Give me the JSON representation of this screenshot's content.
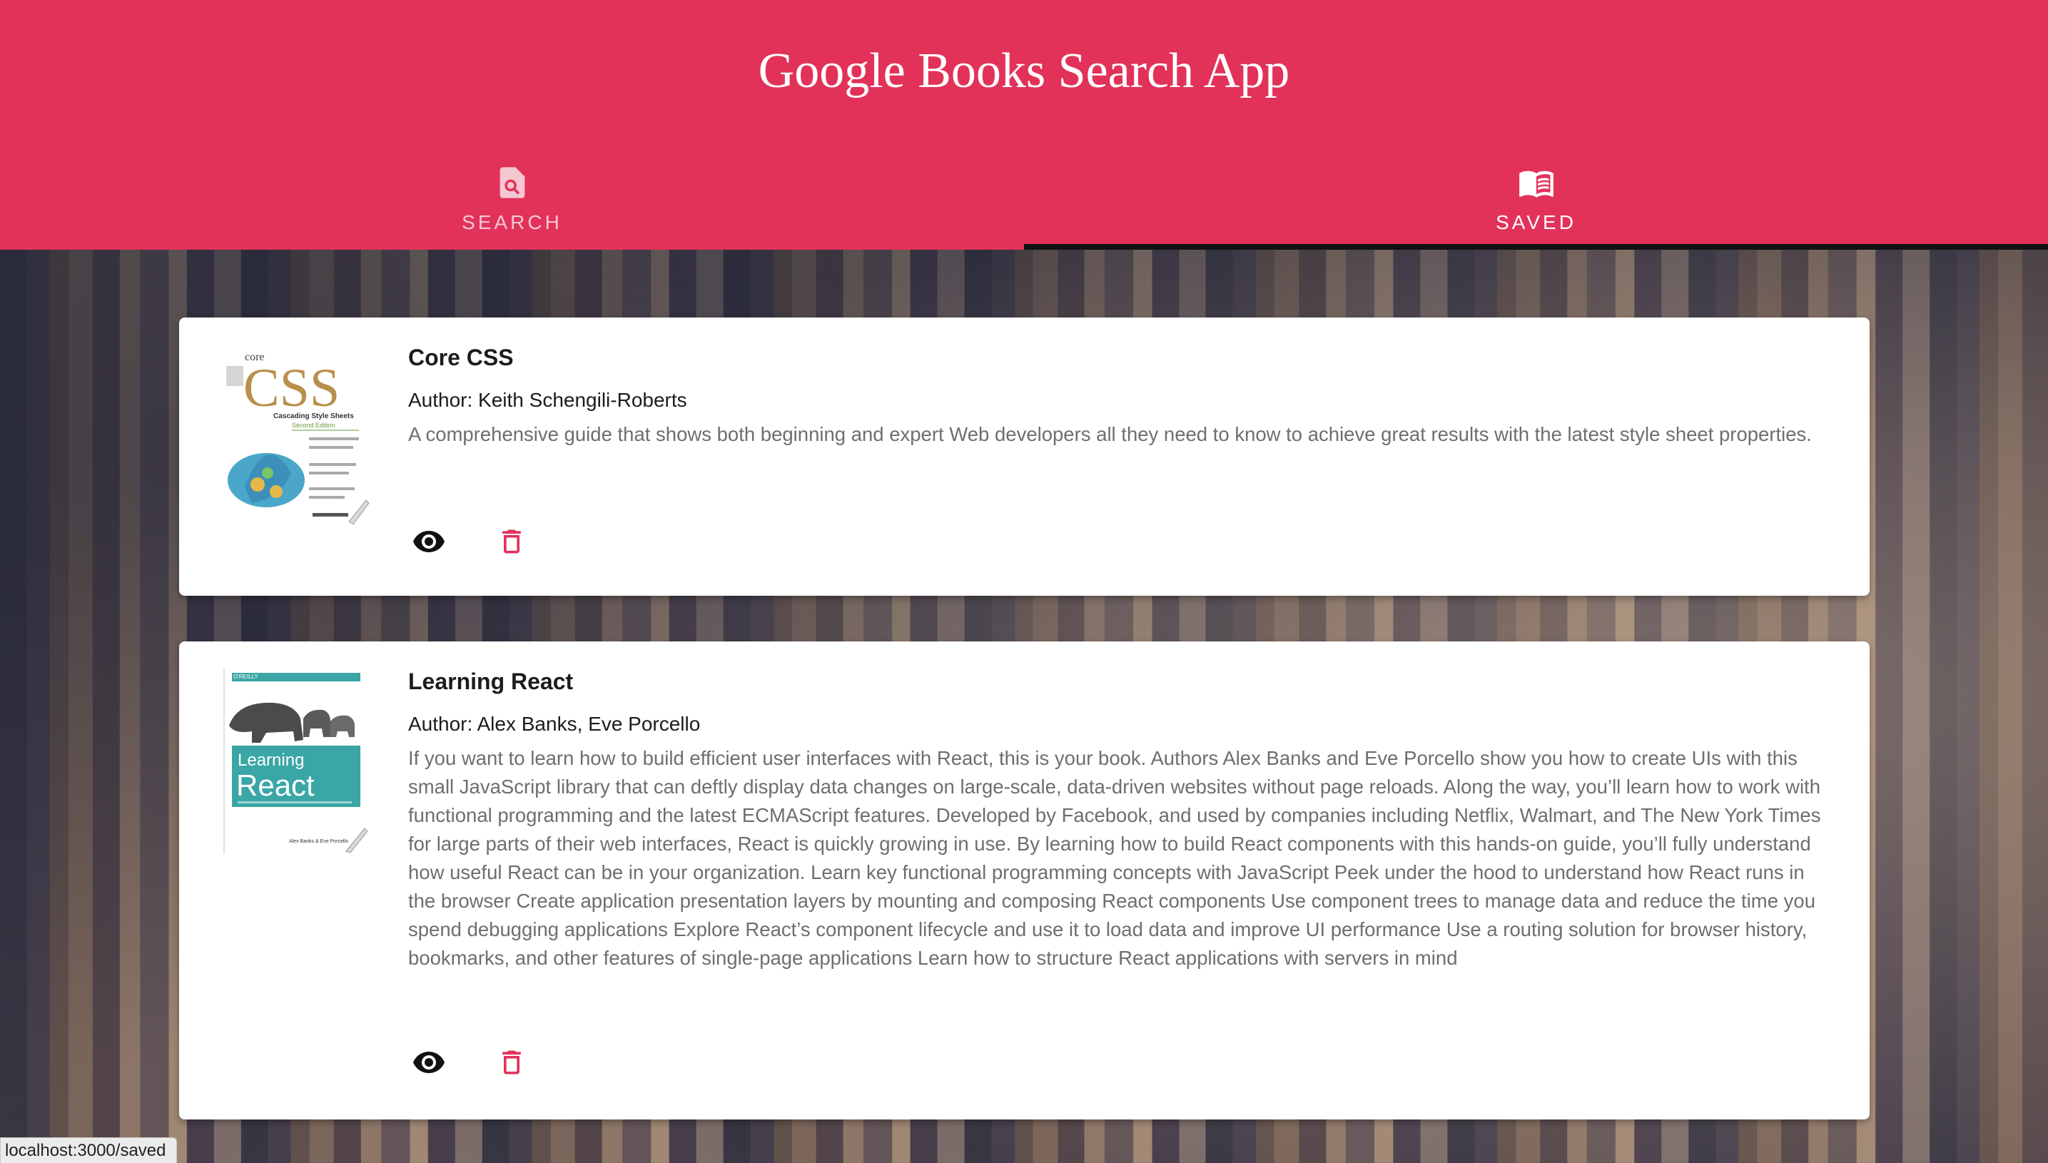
{
  "header": {
    "title": "Google Books Search App"
  },
  "tabs": [
    {
      "label": "SEARCH",
      "icon": "search-document-icon",
      "active": false
    },
    {
      "label": "SAVED",
      "icon": "open-book-icon",
      "active": true
    }
  ],
  "colors": {
    "accent": "#e2325a",
    "indicator": "#111111",
    "delete": "#e2325a"
  },
  "books": [
    {
      "title": "Core CSS",
      "author": "Author: Keith Schengili-Roberts",
      "description": "A comprehensive guide that shows both beginning and expert Web developers all they need to know to achieve great results with the latest style sheet properties.",
      "cover": {
        "top_text": "core",
        "big_text": "CSS",
        "subtitle": "Cascading Style Sheets",
        "edition": "Second Edition"
      }
    },
    {
      "title": "Learning React",
      "author": "Author: Alex Banks, Eve Porcello",
      "description": "If you want to learn how to build efficient user interfaces with React, this is your book. Authors Alex Banks and Eve Porcello show you how to create UIs with this small JavaScript library that can deftly display data changes on large-scale, data-driven websites without page reloads. Along the way, you’ll learn how to work with functional programming and the latest ECMAScript features. Developed by Facebook, and used by companies including Netflix, Walmart, and The New York Times for large parts of their web interfaces, React is quickly growing in use. By learning how to build React components with this hands-on guide, you’ll fully understand how useful React can be in your organization. Learn key functional programming concepts with JavaScript Peek under the hood to understand how React runs in the browser Create application presentation layers by mounting and composing React components Use component trees to manage data and reduce the time you spend debugging applications Explore React’s component lifecycle and use it to load data and improve UI performance Use a routing solution for browser history, bookmarks, and other features of single-page applications Learn how to structure React applications with servers in mind",
      "cover": {
        "publisher": "O'REILLY",
        "line1": "Learning",
        "line2": "React",
        "authors": "Alex Banks & Eve Porcello"
      }
    }
  ],
  "actions": {
    "view_icon": "eye-icon",
    "delete_icon": "trash-icon"
  },
  "status_bar": {
    "url": "localhost:3000/saved"
  }
}
